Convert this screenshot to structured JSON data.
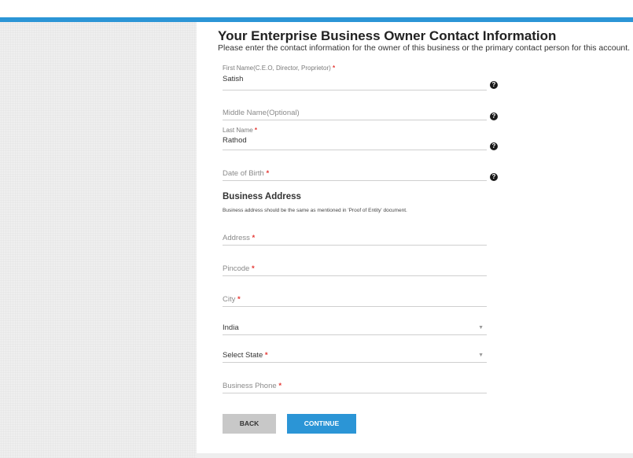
{
  "header": {
    "title": "Your Enterprise Business Owner Contact Information",
    "subtitle": "Please enter the contact information for the owner of this business or the primary contact person for this account."
  },
  "fields": {
    "first_name": {
      "label": "First Name(C.E.O, Director, Proprietor)",
      "required_mark": "*",
      "value": "Satish"
    },
    "middle_name": {
      "placeholder": "Middle Name(Optional)"
    },
    "last_name": {
      "label": "Last Name",
      "required_mark": "*",
      "value": "Rathod"
    },
    "dob": {
      "placeholder": "Date of Birth",
      "required_mark": "*"
    }
  },
  "business_address": {
    "heading": "Business Address",
    "note": "Business address should be the same as mentioned in 'Proof of Entity' document.",
    "address": {
      "placeholder": "Address",
      "required_mark": "*"
    },
    "pincode": {
      "placeholder": "Pincode",
      "required_mark": "*"
    },
    "city": {
      "placeholder": "City",
      "required_mark": "*"
    },
    "country": {
      "value": "India"
    },
    "state": {
      "placeholder": "Select State",
      "required_mark": "*"
    },
    "phone": {
      "placeholder": "Business Phone",
      "required_mark": "*"
    }
  },
  "icons": {
    "help": "?",
    "dropdown": "▼"
  },
  "buttons": {
    "back": "BACK",
    "continue": "CONTINUE"
  },
  "colors": {
    "accent": "#2b95d6",
    "required": "#e53935"
  }
}
